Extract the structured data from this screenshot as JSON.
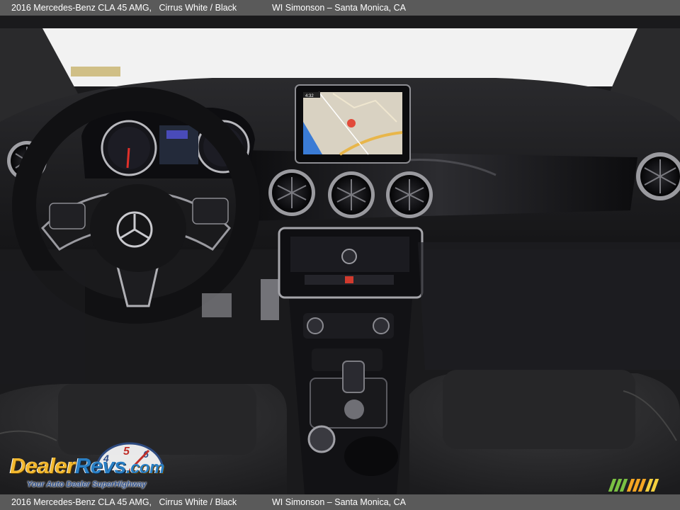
{
  "caption": {
    "vehicle": "2016 Mercedes-Benz CLA 45 AMG,   Cirrus White / Black",
    "dealer": "WI Simonson – Santa Monica, CA"
  },
  "screen": {
    "clock": "4:32"
  },
  "watermark": {
    "brand_part1": "Dealer",
    "brand_part2": "Revs",
    "brand_part3": ".com",
    "tagline": "Your Auto Dealer SuperHighway",
    "gauge_digits": [
      "4",
      "5",
      "6"
    ]
  },
  "colors": {
    "caption_bg": "#5a5a5a",
    "brand_gold": "#f2b82e",
    "brand_blue": "#2a7fc4",
    "stripe_green": "#7ac143",
    "stripe_orange": "#f5a623",
    "stripe_yellow": "#f4d03f"
  }
}
